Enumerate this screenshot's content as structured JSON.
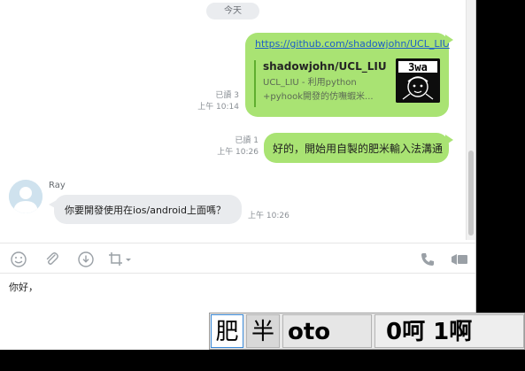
{
  "chat": {
    "date_separator": "今天",
    "link_message": {
      "url": "https://github.com/shadowjohn/UCL_LIU",
      "preview_title": "shadowjohn/UCL_LIU",
      "preview_description": "UCL_LIU - 利用python +pyhook開發的仿嘸蝦米...",
      "read_status": "已讀 3",
      "time": "上午 10:14"
    },
    "text_message": {
      "text": "好的，開始用自製的肥米輸入法溝通",
      "read_status": "已讀 1",
      "time": "上午 10:26"
    },
    "incoming_message": {
      "sender": "Ray",
      "text": "你要開發使用在ios/android上面嗎？",
      "time": "上午 10:26"
    }
  },
  "toolbar": {
    "left_icons": [
      "emoji-icon",
      "paperclip-icon",
      "download-icon",
      "crop-icon"
    ],
    "right_icons": [
      "phone-icon",
      "video-icon"
    ]
  },
  "composer": {
    "text": "你好，"
  },
  "ime": {
    "mode": "肥",
    "width_mode": "半",
    "input_code": "oto",
    "candidates": "0呵 1啊"
  },
  "colors": {
    "outgoing_bubble": "#a9e373",
    "incoming_bubble": "#e9ebee",
    "link": "#1d5fc8"
  }
}
